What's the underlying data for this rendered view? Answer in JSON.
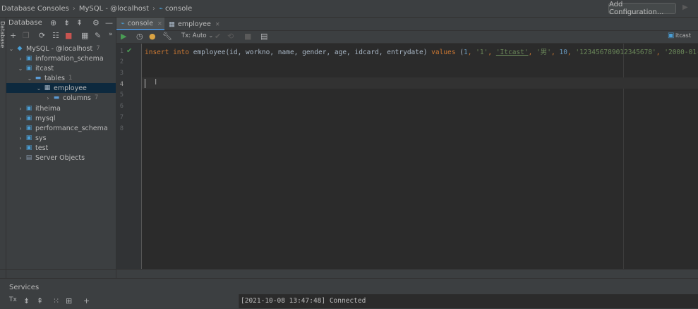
{
  "titlebar": {
    "crumbs": [
      "Database Consoles",
      "MySQL - @localhost",
      "console"
    ],
    "add_config_label": "Add Configuration..."
  },
  "sidebar": {
    "strip_label": "Database",
    "title": "Database",
    "tree": [
      {
        "label": "MySQL - @localhost",
        "count": "7"
      },
      {
        "label": "information_schema"
      },
      {
        "label": "itcast"
      },
      {
        "label": "tables",
        "count": "1"
      },
      {
        "label": "employee"
      },
      {
        "label": "columns",
        "count": "7"
      },
      {
        "label": "itheima"
      },
      {
        "label": "mysql"
      },
      {
        "label": "performance_schema"
      },
      {
        "label": "sys"
      },
      {
        "label": "test"
      },
      {
        "label": "Server Objects"
      }
    ]
  },
  "tabs": [
    {
      "label": "console",
      "active": true
    },
    {
      "label": "employee",
      "active": false
    }
  ],
  "editor_toolbar": {
    "tx_mode": "Tx: Auto",
    "right_label": "itcast"
  },
  "editor": {
    "line_numbers": [
      "1",
      "2",
      "3",
      "4",
      "5",
      "6",
      "7",
      "8"
    ],
    "code": {
      "kw_insert": "insert",
      "kw_into": "into",
      "table": "employee",
      "columns": "(id, workno, name, gender, age, idcard, entrydate)",
      "kw_values": "values",
      "paren_open": "(",
      "v_id": "1",
      "comma": ",",
      "v_workno": "'1'",
      "v_name": "'Itcast'",
      "v_gender": "'男'",
      "v_age": "10",
      "v_idcard": "'123456789012345678'",
      "v_date": "'2000-01-"
    }
  },
  "services": {
    "title": "Services",
    "console_line": "[2021-10-08 13:47:48] Connected"
  },
  "colors": {
    "keyword": "#cc7832",
    "string": "#6a8759",
    "number": "#6897bb",
    "success": "#499c54",
    "selection": "#0d293e"
  }
}
